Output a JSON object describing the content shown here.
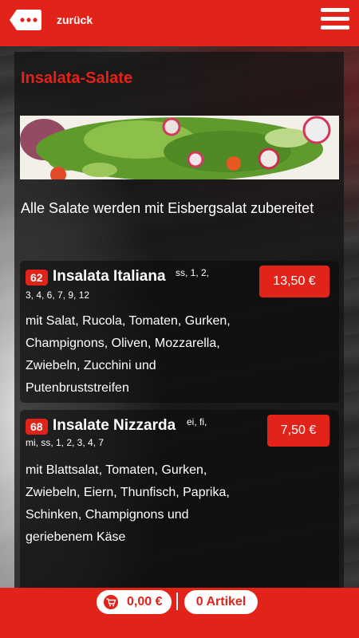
{
  "header": {
    "back_label": "zurück",
    "back_icon": "speech-bubble-back-icon",
    "menu_icon": "hamburger-menu-icon"
  },
  "category": {
    "title": "Insalata-Salate",
    "banner_image": "salad-photo",
    "description": "Alle Salate werden mit Eisbergsalat zubereitet"
  },
  "items": [
    {
      "number": "62",
      "name": "Insalata Italiana",
      "allergens_line1": "ss, 1, 2,",
      "allergens_line2": "3, 4, 6, 7, 9, 12",
      "price": "13,50 €",
      "description": "mit Salat, Rucola, Tomaten, Gurken, Champignons, Oliven, Mozzarella, Zwiebeln, Zucchini und Putenbruststreifen"
    },
    {
      "number": "68",
      "name": "Insalate Nizzarda",
      "allergens_line1": "ei, fi,",
      "allergens_line2": "mi, ss, 1, 2, 3, 4, 7",
      "price": "7,50 €",
      "description": "mit Blattsalat, Tomaten, Gurken, Zwiebeln, Eiern, Thunfisch, Paprika, Schinken, Champignons und geriebenem Käse"
    }
  ],
  "footer": {
    "cart_total": "0,00 €",
    "cart_icon": "shopping-cart-icon",
    "article_count": "0 Artikel"
  },
  "colors": {
    "brand_red": "#e2231a",
    "white": "#ffffff"
  }
}
